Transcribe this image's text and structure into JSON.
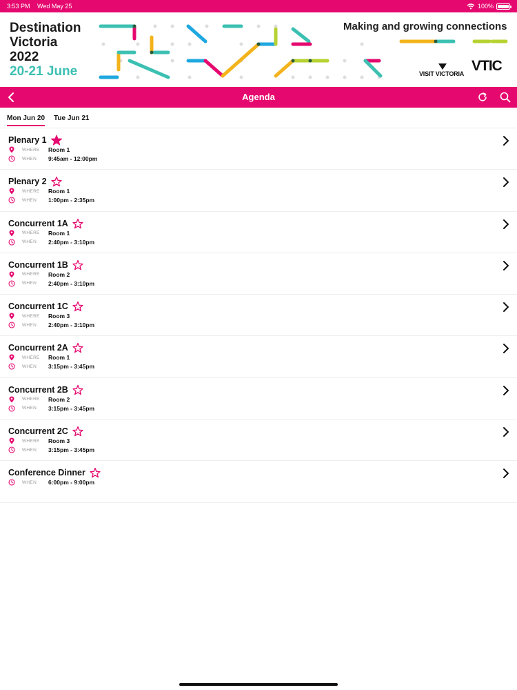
{
  "status_bar": {
    "time": "3:53 PM",
    "date": "Wed May 25",
    "battery": "100%"
  },
  "banner": {
    "title_line1": "Destination",
    "title_line2": "Victoria",
    "title_line3": "2022",
    "dates": "20-21 June",
    "tagline": "Making and growing connections",
    "logo_visit": "VISIT VICTORIA",
    "logo_vtic": "VTIC"
  },
  "nav": {
    "title": "Agenda",
    "back_icon": "chevron-left-icon",
    "refresh_icon": "refresh-icon",
    "search_icon": "search-icon"
  },
  "tabs": [
    {
      "label": "Mon Jun 20",
      "active": true
    },
    {
      "label": "Tue Jun 21",
      "active": false
    }
  ],
  "labels": {
    "where": "WHERE",
    "when": "WHEN"
  },
  "sessions": [
    {
      "title": "Plenary 1",
      "starred": true,
      "where": "Room 1",
      "when": "9:45am - 12:00pm"
    },
    {
      "title": "Plenary 2",
      "starred": false,
      "where": "Room 1",
      "when": "1:00pm - 2:35pm"
    },
    {
      "title": "Concurrent 1A",
      "starred": false,
      "where": "Room 1",
      "when": "2:40pm - 3:10pm"
    },
    {
      "title": "Concurrent 1B",
      "starred": false,
      "where": "Room 2",
      "when": "2:40pm - 3:10pm"
    },
    {
      "title": "Concurrent 1C",
      "starred": false,
      "where": "Room 3",
      "when": "2:40pm - 3:10pm"
    },
    {
      "title": "Concurrent 2A",
      "starred": false,
      "where": "Room 1",
      "when": "3:15pm - 3:45pm"
    },
    {
      "title": "Concurrent 2B",
      "starred": false,
      "where": "Room 2",
      "when": "3:15pm - 3:45pm"
    },
    {
      "title": "Concurrent 2C",
      "starred": false,
      "where": "Room 3",
      "when": "3:15pm - 3:45pm"
    },
    {
      "title": "Conference Dinner",
      "starred": false,
      "where": "",
      "when": "6:00pm - 9:00pm"
    }
  ],
  "colors": {
    "accent": "#e5096f",
    "teal": "#3cc0b2",
    "blue": "#1fa7e0",
    "lime": "#b6d232",
    "yellow": "#f3b31b"
  }
}
